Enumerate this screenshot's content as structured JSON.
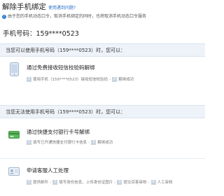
{
  "header": {
    "title": "解除手机绑定",
    "help_link": "使用遇到问题?"
  },
  "notice": {
    "text": "由于您的手机动态口令，取消手机绑定的同时，也将取消手机动态口令服务"
  },
  "phone": {
    "label": "手机号码：159****0523"
  },
  "section_can": {
    "heading": "当您可以使用手机号码（159****0523）时，您可以：",
    "option": {
      "title": "通过免费接收短信校验码解绑",
      "steps": [
        "使用手机（159****0523）接收短信校验码",
        "解绑成功"
      ]
    }
  },
  "section_cannot": {
    "heading": "当您无法使用手机号码（159****0523）时，您可以：",
    "option1": {
      "title": "通过快捷支付银行卡号解绑",
      "steps": [
        "填写已开通快捷支付银行卡信息",
        "解绑成功"
      ]
    },
    "option2": {
      "title": "申请客服人工处理",
      "steps": [
        "提供邮件",
        "填写身份信息，上传身份证图片",
        "提交百客审核",
        "人工审核"
      ]
    }
  },
  "colors": {
    "accent_blue": "#2a6fc9",
    "section_bg": "#eef3f9",
    "bank_card_green": "#5bb85a"
  }
}
